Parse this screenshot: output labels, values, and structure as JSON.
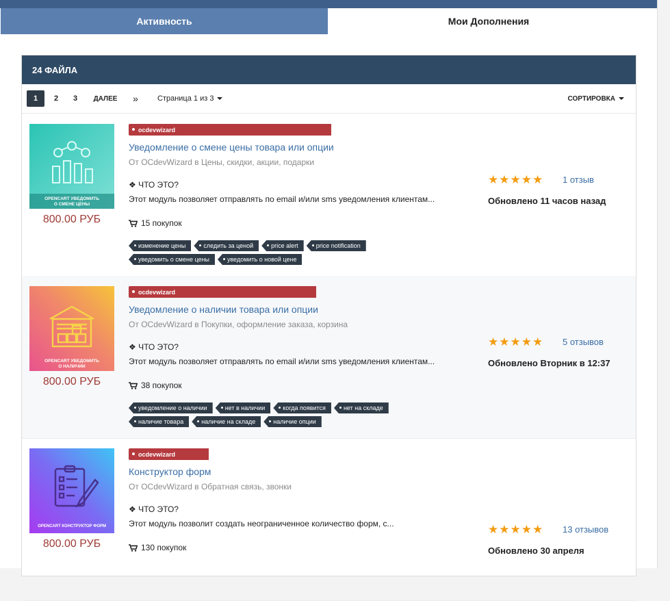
{
  "tabs": {
    "activity": "Активность",
    "mine": "Мои Дополнения"
  },
  "panel": {
    "title": "24 ФАЙЛА"
  },
  "pager": {
    "active": "1",
    "p2": "2",
    "p3": "3",
    "next": "ДАЛЕЕ",
    "last": "»",
    "info": "Страница 1 из 3",
    "sort": "СОРТИРОВКА"
  },
  "common": {
    "what_is": "❖ ЧТО ЭТО?"
  },
  "items": [
    {
      "author_badge": "ocdevwizard",
      "title": "Уведомление о смене цены товара или опции",
      "by_prefix": "От",
      "author": "OCdevWizard",
      "in_word": "в",
      "category": "Цены, скидки, акции, подарки",
      "description": "Этот модуль позволяет отправлять по email и/или sms уведомления клиентам...",
      "purchases": "15 покупок",
      "tags": [
        "изменение цены",
        "следить за ценой",
        "price alert",
        "price notification",
        "уведомить о смене цены",
        "уведомить о новой цене"
      ],
      "stars": "★★★★★",
      "reviews": "1 отзыв",
      "updated": "Обновлено 11 часов назад",
      "price": "800.00 РУБ",
      "thumb_caption_1": "OPENCART УВЕДОМИТЬ",
      "thumb_caption_2": "О СМЕНЕ ЦЕНЫ"
    },
    {
      "author_badge": "ocdevwizard",
      "title": "Уведомление о наличии товара или опции",
      "by_prefix": "От",
      "author": "OCdevWizard",
      "in_word": "в",
      "category": "Покупки, оформление заказа, корзина",
      "description": "Этот модуль позволяет отправлять по email и/или sms уведомления клиентам...",
      "purchases": "38 покупок",
      "tags": [
        "уведомление о наличии",
        "нет в наличии",
        "когда появится",
        "нет на складе",
        "наличие товара",
        "наличие на складе",
        "наличие опции"
      ],
      "stars": "★★★★★",
      "reviews": "5 отзывов",
      "updated": "Обновлено Вторник в 12:37",
      "price": "800.00 РУБ",
      "thumb_caption_1": "OPENCART УВЕДОМИТЬ",
      "thumb_caption_2": "О НАЛИЧИИ"
    },
    {
      "author_badge": "ocdevwizard",
      "title": "Конструктор форм",
      "by_prefix": "От",
      "author": "OCdevWizard",
      "in_word": "в",
      "category": "Обратная связь, звонки",
      "description": "Этот модуль позволит создать неограниченное количество форм, с...",
      "purchases": "130 покупок",
      "tags": [],
      "stars": "★★★★★",
      "reviews": "13 отзывов",
      "updated": "Обновлено 30 апреля",
      "price": "800.00 РУБ",
      "thumb_caption_1": "OPENCART КОНСТРУКТОР ФОРМ",
      "thumb_caption_2": ""
    }
  ],
  "colors": {
    "accent": "#2f4a64",
    "badge": "#b53a3e",
    "link": "#3a6ea5",
    "price": "#9e3b35",
    "star": "#f39c12"
  },
  "icons": {
    "cart": "cart-icon",
    "caret": "caret-down-icon"
  }
}
